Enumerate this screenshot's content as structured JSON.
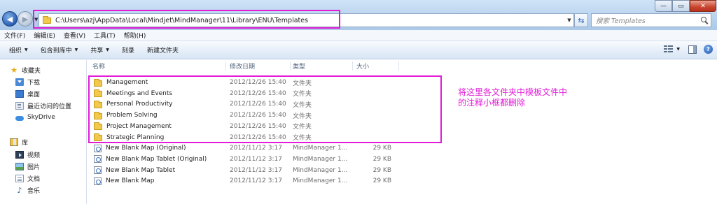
{
  "window": {
    "address": "C:\\Users\\azj\\AppData\\Local\\Mindjet\\MindManager\\11\\Library\\ENU\\Templates",
    "search_placeholder": "搜索 Templates",
    "min_glyph": "—",
    "max_glyph": "▭",
    "close_glyph": "✕"
  },
  "menu": [
    "文件(F)",
    "编辑(E)",
    "查看(V)",
    "工具(T)",
    "帮助(H)"
  ],
  "toolbar": {
    "organize": "组织",
    "include_library": "包含到库中",
    "share": "共享",
    "burn": "刻录",
    "new_folder": "新建文件夹"
  },
  "sidebar": {
    "favorites": {
      "label": "收藏夹",
      "items": [
        "下载",
        "桌面",
        "最近访问的位置"
      ]
    },
    "skydrive": "SkyDrive",
    "libraries": {
      "label": "库",
      "items": [
        "视频",
        "图片",
        "文档",
        "音乐"
      ]
    }
  },
  "columns": {
    "name": "名称",
    "modified": "修改日期",
    "type": "类型",
    "size": "大小"
  },
  "files": [
    {
      "name": "Management",
      "modified": "2012/12/26 15:40",
      "type": "文件夹",
      "size": "",
      "kind": "folder"
    },
    {
      "name": "Meetings and Events",
      "modified": "2012/12/26 15:40",
      "type": "文件夹",
      "size": "",
      "kind": "folder"
    },
    {
      "name": "Personal Productivity",
      "modified": "2012/12/26 15:40",
      "type": "文件夹",
      "size": "",
      "kind": "folder"
    },
    {
      "name": "Problem Solving",
      "modified": "2012/12/26 15:40",
      "type": "文件夹",
      "size": "",
      "kind": "folder"
    },
    {
      "name": "Project Management",
      "modified": "2012/12/26 15:40",
      "type": "文件夹",
      "size": "",
      "kind": "folder"
    },
    {
      "name": "Strategic Planning",
      "modified": "2012/12/26 15:40",
      "type": "文件夹",
      "size": "",
      "kind": "folder"
    },
    {
      "name": "New Blank Map (Original)",
      "modified": "2012/11/12 3:17",
      "type": "MindManager 1...",
      "size": "29 KB",
      "kind": "map"
    },
    {
      "name": "New Blank Map Tablet (Original)",
      "modified": "2012/11/12 3:17",
      "type": "MindManager 1...",
      "size": "29 KB",
      "kind": "map"
    },
    {
      "name": "New Blank Map Tablet",
      "modified": "2012/11/12 3:17",
      "type": "MindManager 1...",
      "size": "29 KB",
      "kind": "map"
    },
    {
      "name": "New Blank Map",
      "modified": "2012/11/12 3:17",
      "type": "MindManager 1...",
      "size": "29 KB",
      "kind": "map"
    }
  ],
  "annotation": {
    "line1": "将这里各文件夹中模板文件中",
    "line2": "的注释小框都删除",
    "color": "#e21cd7"
  }
}
